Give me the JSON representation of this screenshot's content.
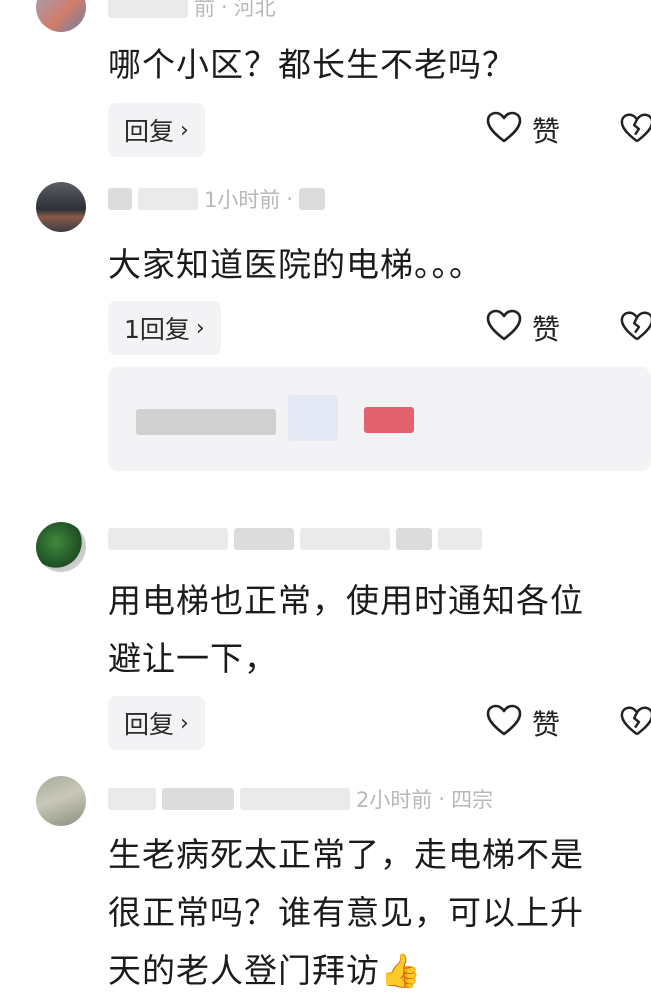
{
  "comments": [
    {
      "meta_time": "前",
      "meta_location": "河北",
      "text": "哪个小区？都长生不老吗？",
      "reply_label": "回复",
      "like_label": "赞"
    },
    {
      "meta_time": "1小时前",
      "meta_location": "",
      "text": "大家知道医院的电梯。。。",
      "reply_label": "1回复",
      "like_label": "赞"
    },
    {
      "meta_time": "",
      "meta_location": "",
      "text_line1": "用电梯也正常，使用时通知各位",
      "text_line2": "避让一下，",
      "reply_label": "回复",
      "like_label": "赞"
    },
    {
      "meta_time": "2小时前",
      "meta_location": "四宗",
      "text_line1": "生老病死太正常了，走电梯不是",
      "text_line2": "很正常吗？谁有意见，可以上升",
      "text_line3": "天的老人登门拜访",
      "emoji": "👍"
    }
  ],
  "icons": {
    "chevron": "chevron-right-icon",
    "like": "heart-outline-icon",
    "dislike": "broken-heart-icon"
  }
}
